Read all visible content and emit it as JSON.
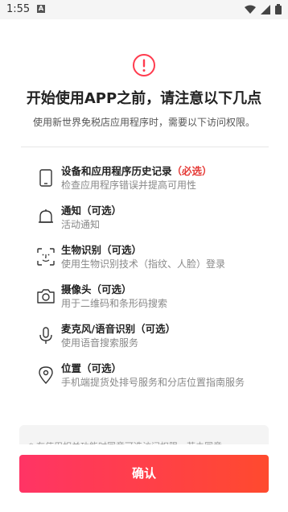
{
  "status_bar": {
    "time": "1:55",
    "notification_icon": "A"
  },
  "header": {
    "title": "开始使用APP之前，请注意以下几点",
    "subtitle": "使用新世界免税店应用程序时，需要以下访问权限。"
  },
  "permissions": [
    {
      "icon": "phone-icon",
      "title": "设备和应用程序历史记录",
      "tag": "（必选）",
      "desc": "检查应用程序错误并提高可用性"
    },
    {
      "icon": "bell-icon",
      "title": "通知（可选）",
      "desc": "活动通知"
    },
    {
      "icon": "face-id-icon",
      "title": "生物识别（可选）",
      "desc": "使用生物识别技术（指纹、人脸）登录"
    },
    {
      "icon": "camera-icon",
      "title": "摄像头（可选）",
      "desc": "用于二维码和条形码搜索"
    },
    {
      "icon": "microphone-icon",
      "title": "麦克风/语音识别（可选）",
      "desc": "使用语音搜索服务"
    },
    {
      "icon": "location-icon",
      "title": "位置（可选）",
      "desc": "手机端提货处排号服务和分店位置指南服务"
    }
  ],
  "notice": {
    "text": "* 在使用相关功能时同意可选访问权限，若未同意"
  },
  "confirm_button": {
    "label": "确认"
  },
  "colors": {
    "accent_start": "#ff3465",
    "accent_end": "#ff4a2e",
    "required": "#e53935"
  }
}
